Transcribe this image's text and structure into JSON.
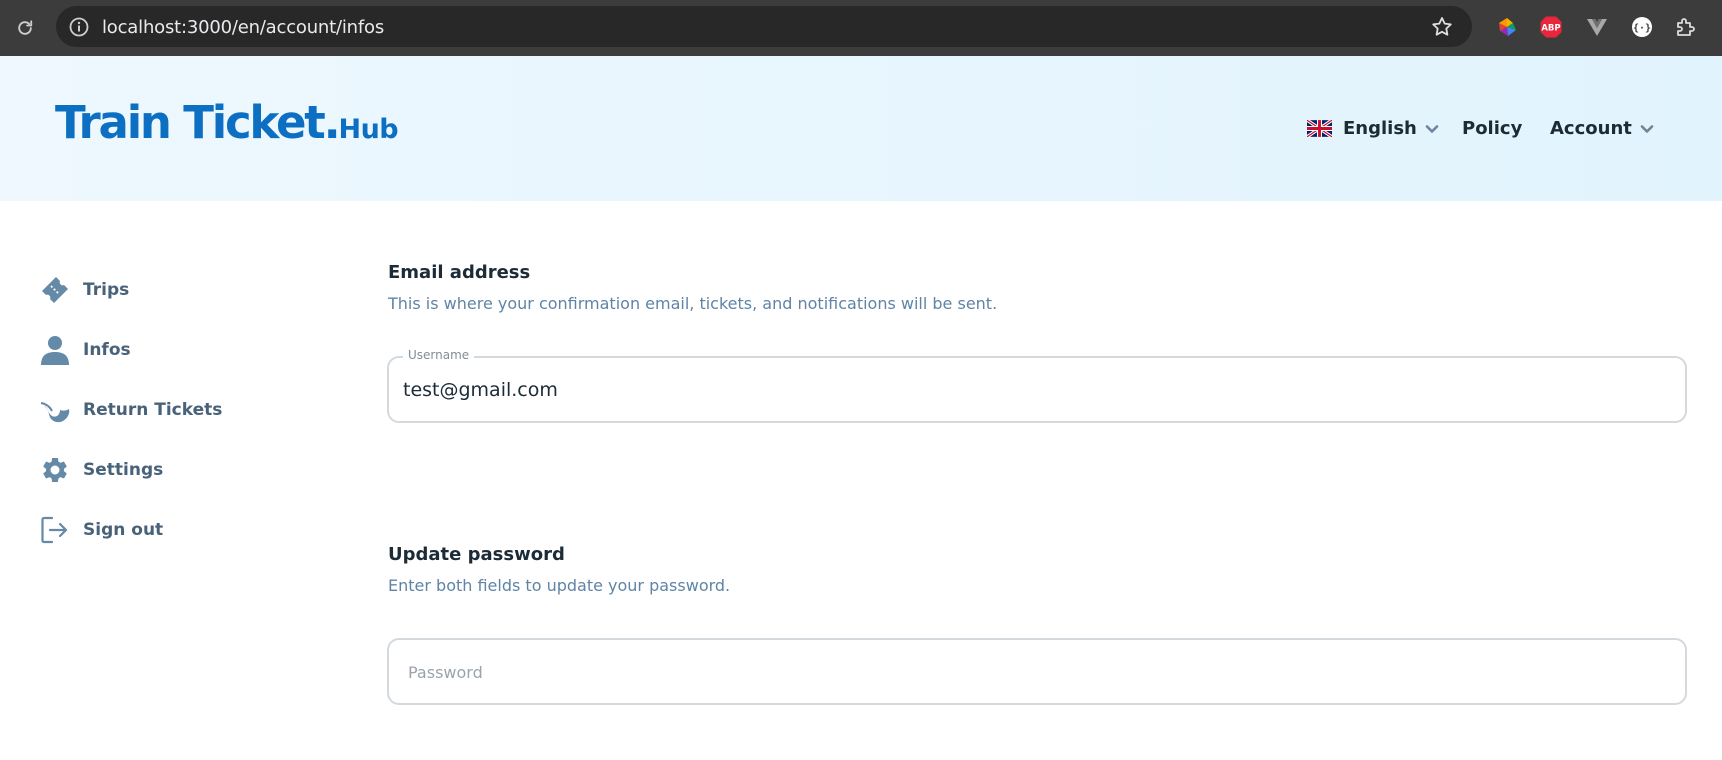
{
  "browser": {
    "url": "localhost:3000/en/account/infos",
    "extensions": [
      "color-picker-extension-icon",
      "adblock-plus-extension-icon",
      "vue-devtools-extension-icon",
      "json-formatter-extension-icon",
      "extensions-puzzle-icon"
    ],
    "adblock_label": "ABP"
  },
  "header": {
    "logo_main": "Train Ticket.",
    "logo_sub": "Hub",
    "brand_color": "#0d6fc2",
    "nav": {
      "language": "English",
      "policy": "Policy",
      "account": "Account"
    }
  },
  "sidebar": {
    "items": [
      {
        "label": "Trips",
        "icon": "ticket-icon"
      },
      {
        "label": "Infos",
        "icon": "user-icon"
      },
      {
        "label": "Return Tickets",
        "icon": "return-icon"
      },
      {
        "label": "Settings",
        "icon": "gear-icon"
      },
      {
        "label": "Sign out",
        "icon": "sign-out-icon"
      }
    ],
    "icon_color": "#658aa8"
  },
  "main": {
    "email_section": {
      "title": "Email address",
      "description": "This is where your confirmation email, tickets, and notifications will be sent.",
      "field_label": "Username",
      "field_value": "test@gmail.com"
    },
    "password_section": {
      "title": "Update password",
      "description": "Enter both fields to update your password.",
      "placeholder": "Password"
    }
  }
}
